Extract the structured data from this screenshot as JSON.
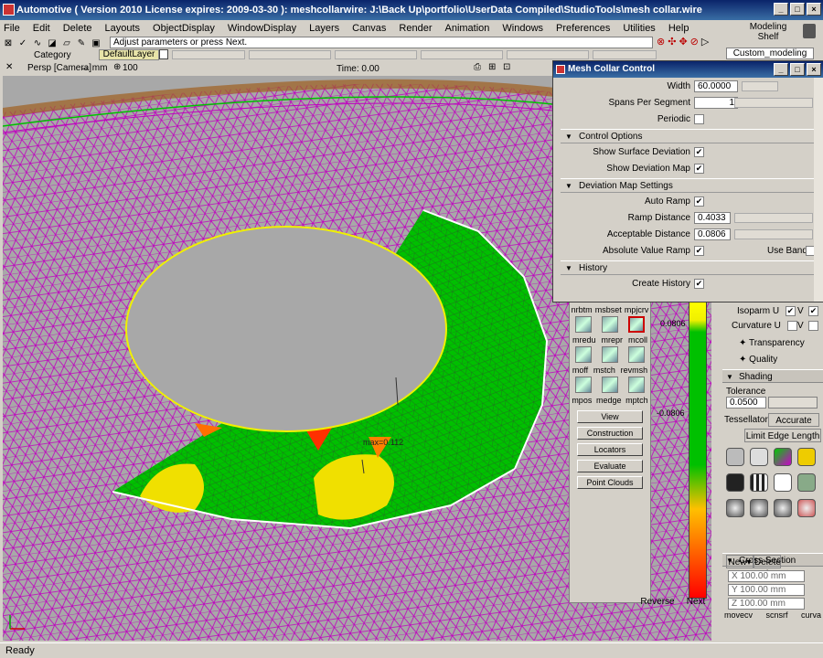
{
  "app": {
    "title": "Automotive ( Version 2010  License expires: 2009-03-30 ): meshcollarwire: J:\\Back Up\\portfolio\\UserData Compiled\\StudioTools\\mesh collar.wire"
  },
  "menu": [
    "File",
    "Edit",
    "Delete",
    "Layouts",
    "ObjectDisplay",
    "WindowDisplay",
    "Layers",
    "Canvas",
    "Render",
    "Animation",
    "Windows",
    "Preferences",
    "Utilities",
    "Help"
  ],
  "prompt": {
    "text": "Adjust parameters or press Next."
  },
  "category": {
    "label": "Category",
    "layer": "DefaultLayer"
  },
  "shelf": {
    "title1": "Modeling",
    "title2": "Shelf",
    "tab": "Custom_modeling"
  },
  "viewport": {
    "camera": "Persp [Camera]",
    "units": "↔ mm",
    "zoom": "100",
    "time": "Time: 0.00",
    "annotation": "max=0.112"
  },
  "dialog": {
    "title": "Mesh Collar Control",
    "width_label": "Width",
    "width_value": "60.0000",
    "spans_label": "Spans Per Segment",
    "spans_value": "1",
    "periodic_label": "Periodic",
    "control_options": "Control Options",
    "show_surface_dev": "Show Surface Deviation",
    "show_dev_map": "Show Deviation Map",
    "dev_map_settings": "Deviation Map Settings",
    "auto_ramp": "Auto Ramp",
    "ramp_distance_label": "Ramp Distance",
    "ramp_distance_value": "0.4033",
    "acceptable_label": "Acceptable Distance",
    "acceptable_value": "0.0806",
    "abs_ramp": "Absolute Value Ramp",
    "use_bands": "Use Bands",
    "history": "History",
    "create_history": "Create History",
    "check": "✔"
  },
  "palette": {
    "row1": [
      "nrbtm",
      "msbset",
      "mpjcrv"
    ],
    "row2": [
      "mredu",
      "mrepr",
      "mcoll"
    ],
    "row3": [
      "moff",
      "mstch",
      "revmsh"
    ],
    "row4": [
      "mpos",
      "medge",
      "mptch"
    ],
    "buttons": [
      "View",
      "Construction",
      "Locators",
      "Evaluate",
      "Point Clouds"
    ]
  },
  "ramp": {
    "top_label": "0.0806",
    "mid_label": "-0.0806"
  },
  "nav": {
    "reverse": "Reverse",
    "next": "Next"
  },
  "right_panel": {
    "isoparm": "Isoparm U",
    "curvature": "Curvature U",
    "v": "V",
    "transparency": "Transparency",
    "quality": "Quality",
    "shading": "Shading",
    "tolerance": "Tolerance",
    "tolerance_value": "0.0500",
    "tessellator": "Tessellator",
    "accurate": "Accurate",
    "limit_edge": "Limit Edge Length",
    "cross_section": "Cross Section Control",
    "new": "New",
    "delete": "Delete",
    "x_value": "X 100.00 mm",
    "y_value": "Y 100.00 mm",
    "z_value": "Z 100.00 mm",
    "bottom_tools": [
      "movecv",
      "scnsrf",
      "curva"
    ]
  },
  "status": {
    "text": "Ready"
  },
  "colors": {
    "mesh": "#c000c0",
    "green": "#00c000",
    "yellow": "#f0e000",
    "titlebar": "#0a246a"
  }
}
